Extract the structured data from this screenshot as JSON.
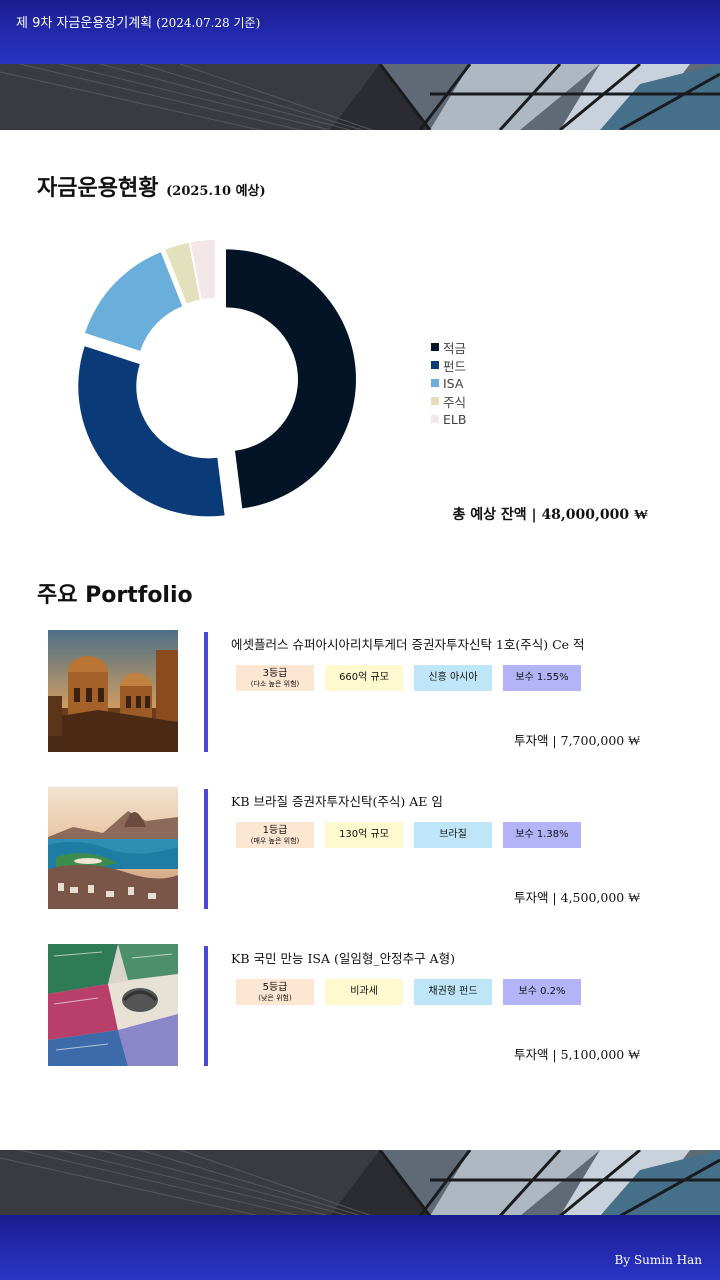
{
  "header": {
    "title": "제 9차 자금운용장기계획",
    "subtitle": "(2024.07.28 기준)"
  },
  "status": {
    "title": "자금운용현황",
    "subtitle": "(2025.10 예상)",
    "total_label": "총 예상 잔액",
    "separator": "|",
    "total_value": "48,000,000 ₩"
  },
  "chart_data": {
    "type": "pie",
    "donut": true,
    "categories": [
      "적금",
      "펀드",
      "ISA",
      "주식",
      "ELB"
    ],
    "values": [
      48,
      32,
      14,
      3,
      3
    ],
    "colors": [
      "#031426",
      "#0a3a78",
      "#6aaedb",
      "#e3e1bd",
      "#f4e7ea"
    ],
    "legend_position": "right"
  },
  "portfolio": {
    "title": "주요 Portfolio",
    "items": [
      {
        "name": "에셋플러스 슈퍼아시아리치투게더 증권자투자신탁 1호(주식) Ce 적",
        "risk": "3등급",
        "risk_note": "(다소 높은 위험)",
        "size": "660억 규모",
        "region": "신흥 아시아",
        "fee": "보수 1.55%",
        "invest": "투자액 | 7,700,000 ₩",
        "thumb": "asia-palace"
      },
      {
        "name": "KB 브라질 증권자투자신탁(주식) AE 임",
        "risk": "1등급",
        "risk_note": "(매우 높은 위험)",
        "size": "130억 규모",
        "region": "브라질",
        "fee": "보수 1.38%",
        "invest": "투자액 | 4,500,000 ₩",
        "thumb": "rio-coast"
      },
      {
        "name": "KB 국민 만능 ISA (일임형_안정추구 A형)",
        "risk": "5등급",
        "risk_note": "(낮은 위험)",
        "size": "비과세",
        "region": "채권형 펀드",
        "fee": "보수 0.2%",
        "invest": "투자액 | 5,100,000 ₩",
        "thumb": "bond-certificates"
      }
    ]
  },
  "footer": {
    "credit": "By Sumin Han"
  }
}
